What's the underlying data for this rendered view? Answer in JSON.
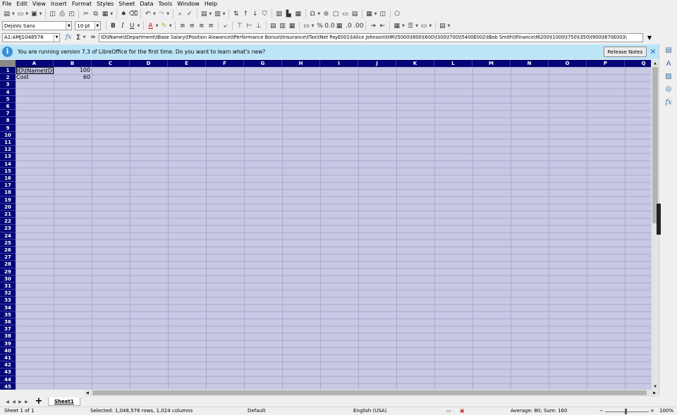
{
  "menu": [
    "File",
    "Edit",
    "View",
    "Insert",
    "Format",
    "Styles",
    "Sheet",
    "Data",
    "Tools",
    "Window",
    "Help"
  ],
  "font_name": "DejaVu Sans",
  "font_size": "10 pt",
  "name_box": "A1:AMJ1048576",
  "formula": "ID\\tName\\tDepartment\\tBase Salary\\tPosition Alowance\\tPerformance Bonus\\tInsurance\\tTax\\tNet PayE001\\tAlice Johnson\\tHR\\t5000\\t800\\t600\\t300\\t700\\t5400E002\\tBob Smith\\tFinance\\t6200\\t1000\\t750\\t350\\t900\\t670E003\\",
  "infobar": {
    "message": "You are running version 7.3 of LibreOffice for the first time. Do you want to learn what's new?",
    "button": "Release Notes"
  },
  "columns": [
    "A",
    "B",
    "C",
    "D",
    "E",
    "F",
    "G",
    "H",
    "I",
    "J",
    "K",
    "L",
    "M",
    "N",
    "O",
    "P",
    "Q"
  ],
  "cells": {
    "A1": "ID\\tName\\tD",
    "B1": "100",
    "A2": "Cost",
    "B2": "60"
  },
  "sheet_tab": "Sheet1",
  "status": {
    "sheet": "Sheet 1 of 1",
    "selection": "Selected: 1,048,576 rows, 1,024 columns",
    "style": "Default",
    "language": "English (USA)",
    "summary": "Average: 80; Sum: 160",
    "zoom": "100%"
  },
  "colors": {
    "selection": "#c7c8e4",
    "header_selected": "#05057a",
    "infobar": "#bde5f8"
  }
}
